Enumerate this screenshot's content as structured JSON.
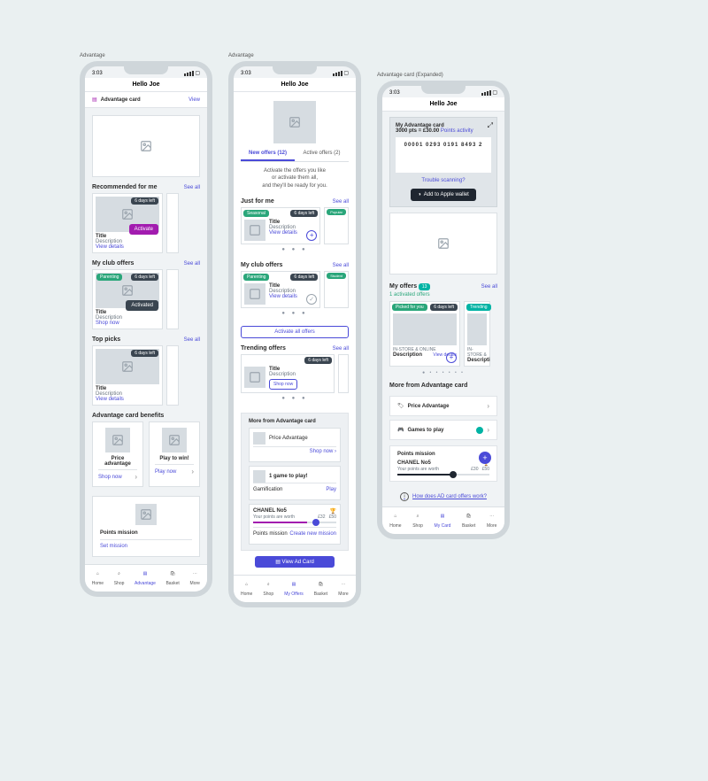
{
  "status": {
    "time": "3:03"
  },
  "header": {
    "greeting": "Hello Joe"
  },
  "frame_labels": {
    "a": "Advantage",
    "b": "Advantage",
    "c": "Advantage card (Expanded)"
  },
  "adv_row": {
    "label": "Advantage card",
    "view": "View"
  },
  "recommended": {
    "title": "Recommended for me",
    "see_all": "See all",
    "days_left": "6 days left",
    "card_title": "Title",
    "desc": "Description",
    "view_details": "View details",
    "activate": "Activate"
  },
  "club": {
    "title": "My club offers",
    "see_all": "See all",
    "tag": "Parenting",
    "days_left": "6 days left",
    "card_title": "Title",
    "desc": "Description",
    "shop_now": "Shop now",
    "activated": "Activated"
  },
  "top": {
    "title": "Top picks",
    "see_all": "See all",
    "days_left": "6 days left",
    "card_title": "Title",
    "desc": "Description",
    "view_details": "View details"
  },
  "benefits": {
    "title": "Advantage card benefits",
    "a_title": "Price advantage",
    "a_link": "Shop now",
    "b_title": "Play to win!",
    "b_link": "Play now"
  },
  "mission": {
    "title": "Points mission",
    "set": "Set mission"
  },
  "tabbar": {
    "home": "Home",
    "shop": "Shop",
    "adv": "Advantage",
    "offers": "My Offers",
    "card": "My Card",
    "basket": "Basket",
    "more": "More"
  },
  "p2": {
    "tab_new": "New offers (12)",
    "tab_active": "Active offers (2)",
    "helper": "Activate the offers you like\nor activate them all,\nand they'll be ready for you.",
    "just": {
      "title": "Just for me",
      "see_all": "See all",
      "tag": "Seasonal",
      "tag2": "Popular",
      "days": "6 days left",
      "t": "Title",
      "d": "Description",
      "vd": "View details"
    },
    "club": {
      "title": "My club offers",
      "see_all": "See all",
      "tag": "Parenting",
      "tag2": "Student",
      "days": "6 days left",
      "t": "Title",
      "d": "Description",
      "vd": "View details"
    },
    "activate_all": "Activate all offers",
    "trend": {
      "title": "Trending offers",
      "see_all": "See all",
      "days": "6 days left",
      "t": "Title",
      "d": "Description",
      "sn": "Shop now"
    },
    "more_title": "More from Advantage card",
    "price_adv": "Price Advantage",
    "shop_now": "Shop now",
    "game": "1 game to play!",
    "gamif": "Gamification",
    "play": "Play",
    "chanel": "CHANEL No5",
    "worth": "Your points are worth",
    "v1": "£32",
    "v2": "£50",
    "mission": "Points mission",
    "create": "Create new mission",
    "view_card": "View Ad Card"
  },
  "p3": {
    "card_title": "My Advantage card",
    "pts": "3000 pts = £30.00",
    "activity": "Points activity",
    "barcode": "00001 0293 0191 8493 2",
    "trouble": "Trouble scanning?",
    "wallet": "Add to Apple wallet",
    "offers_title": "My offers",
    "count": "13",
    "activated": "1 activated offers",
    "see_all": "See all",
    "picked": "Picked for you",
    "days": "6 days left",
    "trending": "Trending",
    "instore": "IN-STORE & ONLINE",
    "desc": "Description",
    "vd": "View details",
    "more_title": "More from Advantage card",
    "price_adv": "Price Advantage",
    "games": "Games to play",
    "mission": "Points mission",
    "chanel": "CHANEL No5",
    "worth": "Your points are worth",
    "v1": "£30",
    "v2": "£50",
    "how": "How does AD card offers work?"
  }
}
